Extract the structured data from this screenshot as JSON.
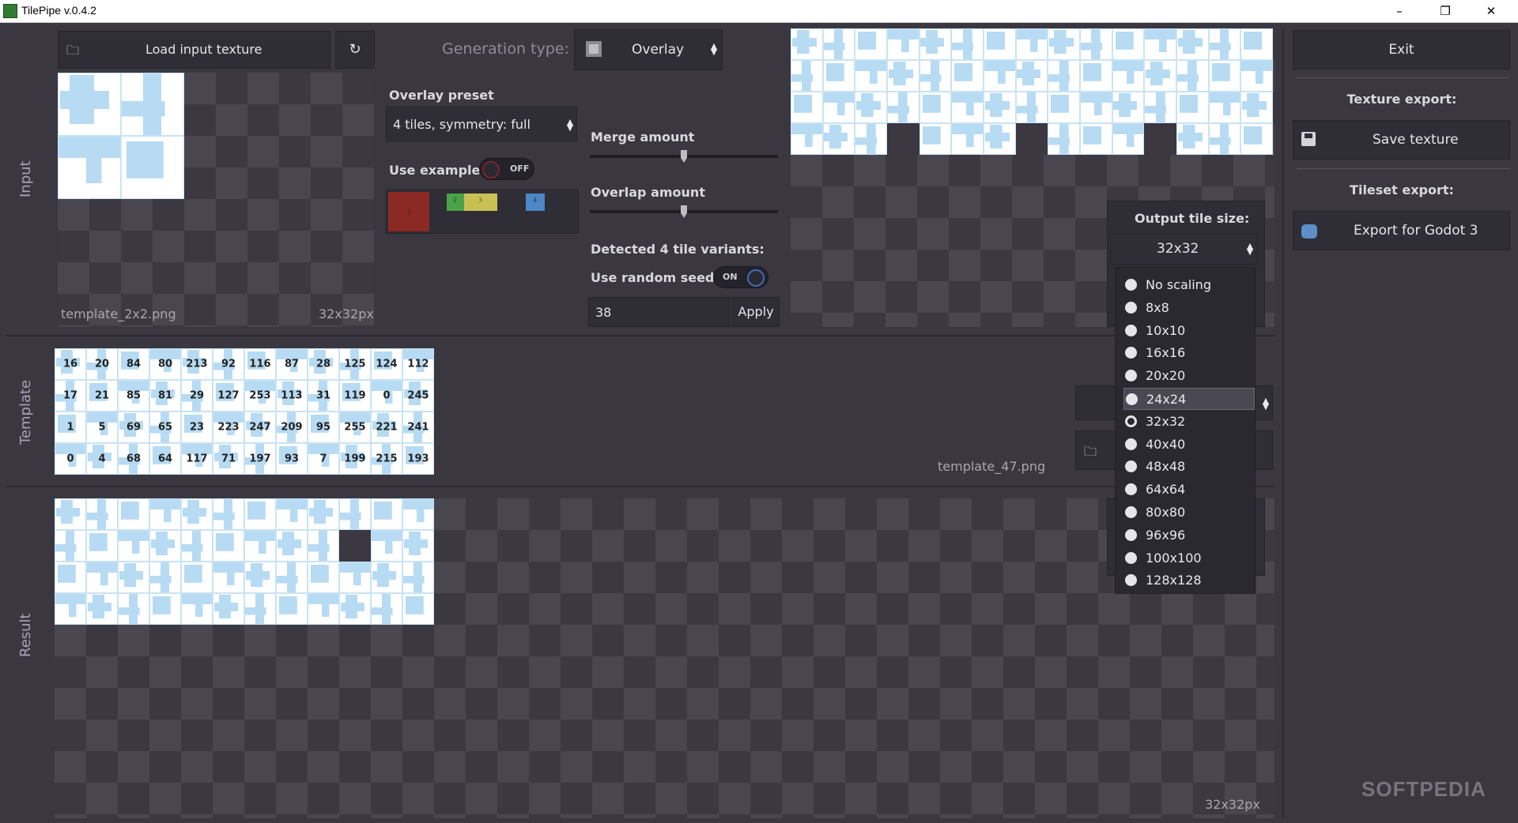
{
  "window": {
    "title": "TilePipe v.0.4.2",
    "minimize": "–",
    "maximize": "❐",
    "close": "✕"
  },
  "input_panel": {
    "section_label": "Input",
    "load_button": "Load input texture",
    "reload_icon": "↻",
    "filename": "template_2x2.png",
    "size": "32x32px"
  },
  "generation": {
    "label": "Generation type:",
    "value": "Overlay",
    "overlay_preset_label": "Overlay preset",
    "overlay_preset_value": "4 tiles, symmetry: full",
    "use_example_label": "Use example",
    "use_example_state": "OFF",
    "merge_label": "Merge amount",
    "merge_value": 0.5,
    "overlap_label": "Overlap amount",
    "overlap_value": 0.5,
    "detected_label": "Detected 4 tile variants:",
    "random_seed_label": "Use random seed",
    "random_seed_state": "ON",
    "seed_value": "38",
    "apply_button": "Apply",
    "swatch_labels": [
      "1",
      "2",
      "3",
      "4"
    ]
  },
  "template_panel": {
    "section_label": "Template",
    "filename": "template_47.png",
    "rows": [
      [
        "16",
        "20",
        "84",
        "80",
        "213",
        "92",
        "116",
        "87",
        "28",
        "125",
        "124",
        "112"
      ],
      [
        "17",
        "21",
        "85",
        "81",
        "29",
        "127",
        "253",
        "113",
        "31",
        "119",
        "0",
        "245"
      ],
      [
        "1",
        "5",
        "69",
        "65",
        "23",
        "223",
        "247",
        "209",
        "95",
        "255",
        "221",
        "241"
      ],
      [
        "0",
        "4",
        "68",
        "64",
        "117",
        "71",
        "197",
        "93",
        "7",
        "199",
        "215",
        "193"
      ]
    ]
  },
  "result_panel": {
    "section_label": "Result",
    "size": "32x32px"
  },
  "right_panel": {
    "exit_button": "Exit",
    "texture_export_label": "Texture export:",
    "save_button": "Save texture",
    "tileset_export_label": "Tileset export:",
    "godot_button": "Export for Godot 3"
  },
  "output_tile_size": {
    "label": "Output tile size:",
    "value": "32x32",
    "options": [
      "No scaling",
      "8x8",
      "10x10",
      "16x16",
      "20x20",
      "24x24",
      "32x32",
      "40x40",
      "48x48",
      "64x64",
      "80x80",
      "96x96",
      "100x100",
      "128x128"
    ],
    "selected": "32x32",
    "hovered": "24x24"
  },
  "watermark": "SOFTPEDIA"
}
